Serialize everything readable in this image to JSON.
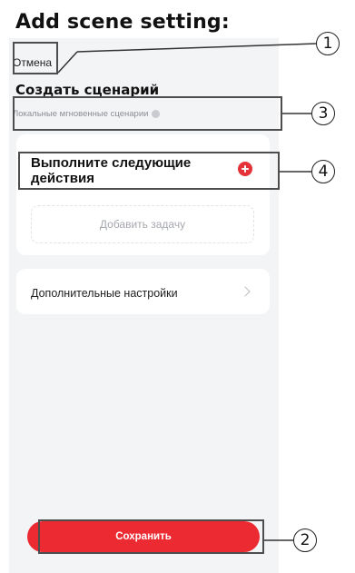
{
  "page_heading": "Add scene setting:",
  "app": {
    "cancel_label": "Отмена",
    "title": "Создать сценарий",
    "subtitle": "Локальные мгновенные сценарии",
    "actions_title": "Выполните следующие действия",
    "add_task_label": "Добавить задачу",
    "settings_label": "Дополнительные настройки",
    "save_label": "Сохранить",
    "accent_color": "#ec2a32"
  },
  "annotations": [
    {
      "number": "1"
    },
    {
      "number": "2"
    },
    {
      "number": "3"
    },
    {
      "number": "4"
    }
  ]
}
